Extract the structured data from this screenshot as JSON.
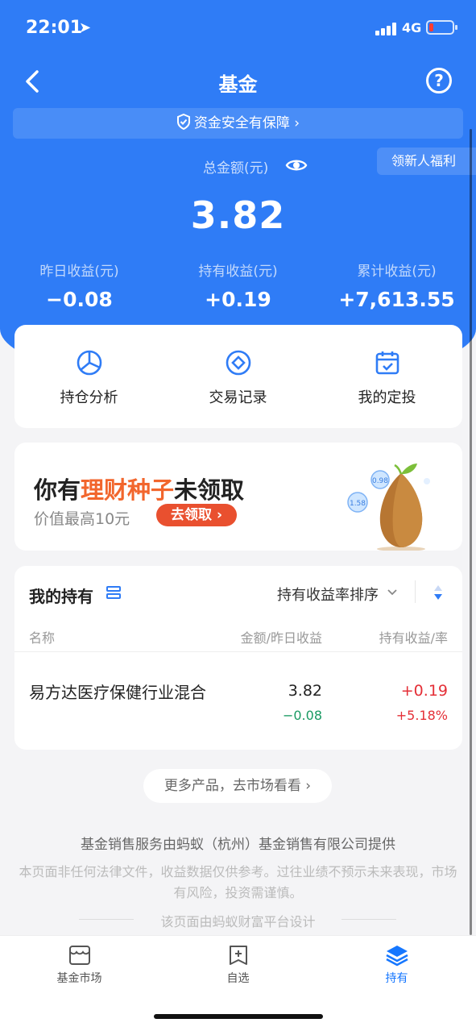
{
  "status": {
    "time": "22:01",
    "network": "4G"
  },
  "nav": {
    "title": "基金"
  },
  "safe_bar": {
    "label": "资金安全有保障 ›"
  },
  "newbie": {
    "label": "领新人福利"
  },
  "summary": {
    "total_label": "总金额(元)",
    "total_value": "3.82",
    "metrics": [
      {
        "label": "昨日收益(元)",
        "value": "−0.08"
      },
      {
        "label": "持有收益(元)",
        "value": "+0.19"
      },
      {
        "label": "累计收益(元)",
        "value": "+7,613.55"
      }
    ]
  },
  "quick_actions": [
    {
      "label": "持仓分析",
      "icon": "pie-chart-icon"
    },
    {
      "label": "交易记录",
      "icon": "record-icon"
    },
    {
      "label": "我的定投",
      "icon": "calendar-icon"
    }
  ],
  "promo": {
    "title_pre": "你有",
    "title_highlight": "理财种子",
    "title_post": "未领取",
    "subtitle": "价值最高10元",
    "button": "去领取 ›",
    "bubble_1": "0.98",
    "bubble_2": "1.58"
  },
  "holdings": {
    "title": "我的持有",
    "sort_label": "持有收益率排序",
    "columns": {
      "name": "名称",
      "amount": "金额/昨日收益",
      "gain": "持有收益/率"
    },
    "rows": [
      {
        "name": "易方达医疗保健行业混合",
        "amount": "3.82",
        "yesterday": "−0.08",
        "gain": "+0.19",
        "rate": "+5.18%"
      }
    ]
  },
  "more_button": "更多产品，去市场看看 ›",
  "disclaimer": {
    "line1": "基金销售服务由蚂蚁（杭州）基金销售有限公司提供",
    "line2": "本页面非任何法律文件，收益数据仅供参考。过往业绩不预示未来表现，市场有风险，投资需谨慎。",
    "line3": "该页面由蚂蚁财富平台设计"
  },
  "tabbar": [
    {
      "label": "基金市场",
      "icon": "market-icon"
    },
    {
      "label": "自选",
      "icon": "watchlist-icon"
    },
    {
      "label": "持有",
      "icon": "holdings-icon"
    }
  ],
  "colors": {
    "brand": "#2f7cf6",
    "red": "#e42f37",
    "green": "#1a9a63",
    "orange": "#f2662d"
  }
}
